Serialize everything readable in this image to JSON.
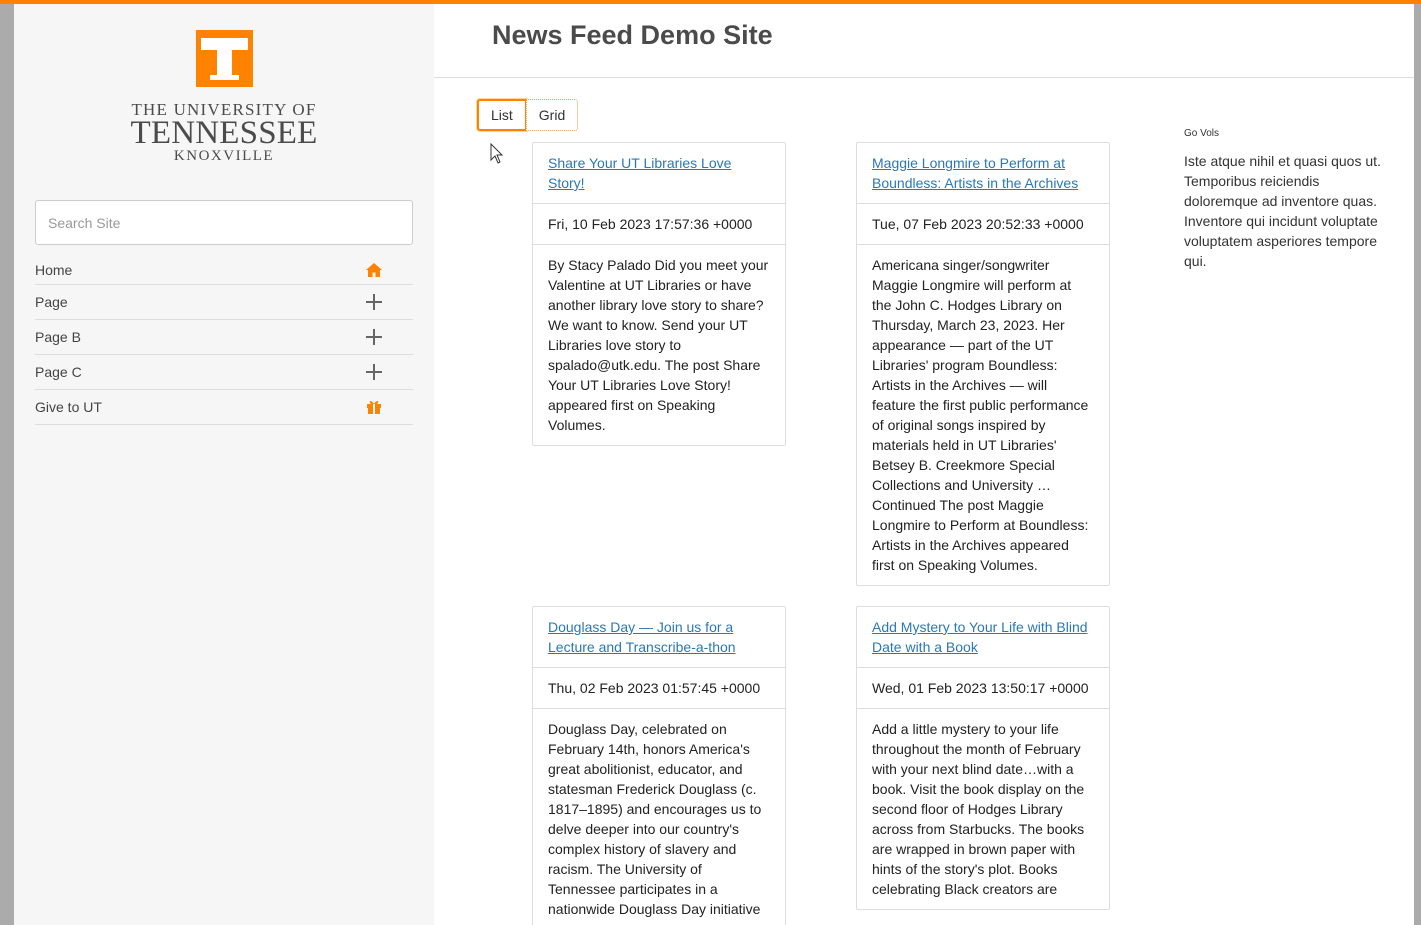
{
  "sidebar": {
    "logo": {
      "line1": "THE UNIVERSITY OF",
      "line2": "TENNESSEE",
      "line3": "KNOXVILLE"
    },
    "search_placeholder": "Search Site",
    "nav": [
      {
        "label": "Home",
        "icon": "home-icon"
      },
      {
        "label": "Page",
        "icon": "plus-icon"
      },
      {
        "label": "Page B",
        "icon": "plus-icon"
      },
      {
        "label": "Page C",
        "icon": "plus-icon"
      },
      {
        "label": "Give to UT",
        "icon": "gift-icon"
      }
    ],
    "accent_color": "#ff8200"
  },
  "header": {
    "title": "News Feed Demo Site"
  },
  "view_toggle": {
    "list_label": "List",
    "grid_label": "Grid"
  },
  "posts": [
    {
      "title": "Share Your UT Libraries Love Story!",
      "date": "Fri, 10 Feb 2023 17:57:36 +0000",
      "body": "By Stacy Palado Did you meet your Valentine at UT Libraries or have another library love story to share? We want to know. Send your UT Libraries love story to spalado@utk.edu. The post Share Your UT Libraries Love Story! appeared first on Speaking Volumes."
    },
    {
      "title": "Maggie Longmire to Perform at Boundless: Artists in the Archives",
      "date": "Tue, 07 Feb 2023 20:52:33 +0000",
      "body": "Americana singer/songwriter Maggie Longmire will perform at the John C. Hodges Library on Thursday, March 23, 2023. Her appearance — part of the UT Libraries' program Boundless: Artists in the Archives — will feature the first public performance of original songs inspired by materials held in UT Libraries' Betsey B. Creekmore Special Collections and University … Continued The post Maggie Longmire to Perform at Boundless: Artists in the Archives appeared first on Speaking Volumes."
    },
    {
      "title": "Douglass Day — Join us for a Lecture and Transcribe-a-thon",
      "date": "Thu, 02 Feb 2023 01:57:45 +0000",
      "body": "Douglass Day, celebrated on February 14th, honors America's great abolitionist, educator, and statesman Frederick Douglass (c. 1817–1895) and encourages us to delve deeper into our country's complex history of slavery and racism. The University of Tennessee participates in a nationwide Douglass Day initiative"
    },
    {
      "title": "Add Mystery to Your Life with Blind Date with a Book",
      "date": "Wed, 01 Feb 2023 13:50:17 +0000",
      "body": "Add a little mystery to your life throughout the month of February with your next blind date…with a book. Visit the book display on the second floor of Hodges Library across from Starbucks. The books are wrapped in brown paper with hints of the story's plot. Books celebrating Black creators are"
    }
  ],
  "aside": {
    "heading": "Go Vols",
    "text": "Iste atque nihil et quasi quos ut. Temporibus reiciendis doloremque ad inventore quas. Inventore qui incidunt voluptate voluptatem asperiores tempore qui."
  }
}
